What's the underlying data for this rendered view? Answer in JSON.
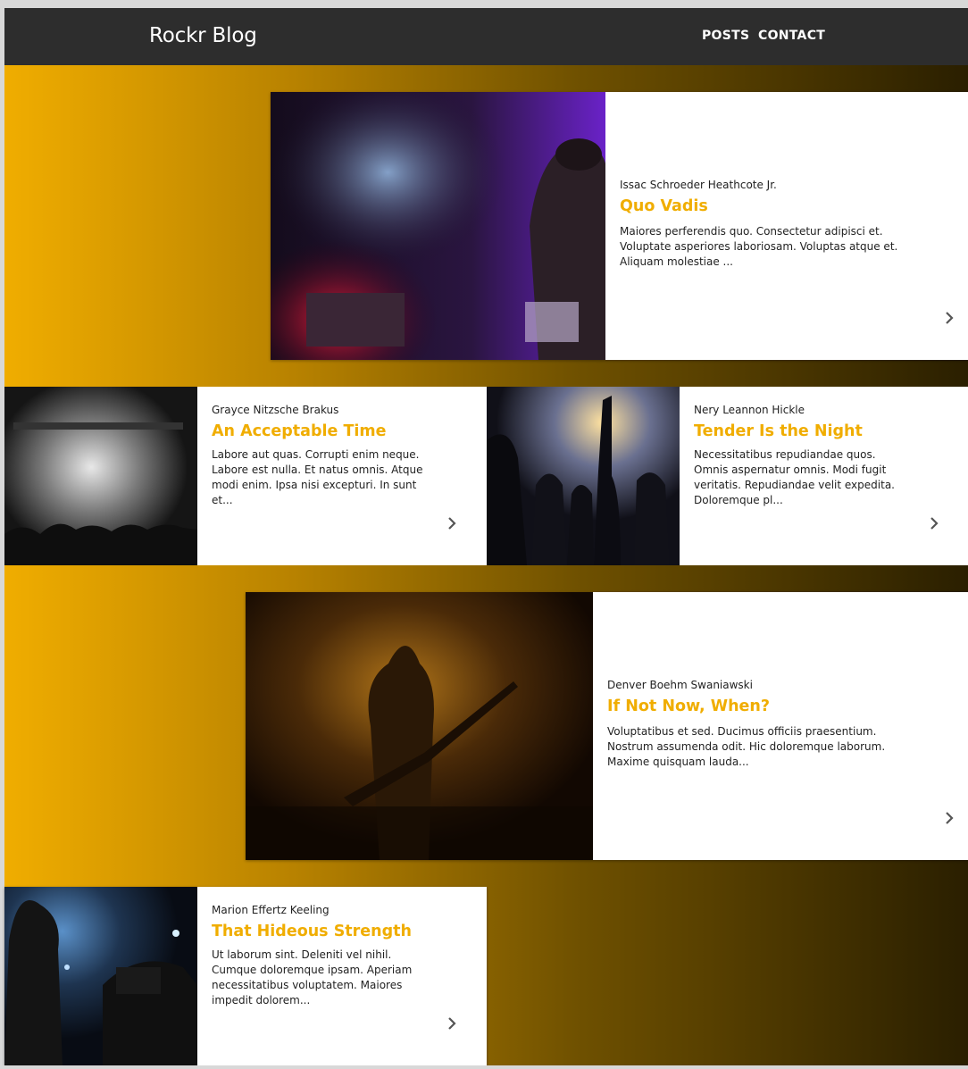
{
  "brand": "Rockr Blog",
  "nav": {
    "posts": "POSTS",
    "contact": "CONTACT"
  },
  "colors": {
    "accent": "#f0ad00",
    "navbar": "#2d2d2d"
  },
  "posts": [
    {
      "author": "Issac Schroeder Heathcote Jr.",
      "title": "Quo Vadis",
      "excerpt": "Maiores perferendis quo. Consectetur adipisci et. Voluptate asperiores laboriosam. Voluptas atque et. Aliquam molestiae ...",
      "icon": "chevron-right-icon"
    },
    {
      "author": "Grayce Nitzsche Brakus",
      "title": "An Acceptable Time",
      "excerpt": "Labore aut quas. Corrupti enim neque. Labore est nulla. Et natus omnis. Atque modi enim. Ipsa nisi excepturi. In sunt et...",
      "icon": "chevron-right-icon"
    },
    {
      "author": "Nery Leannon Hickle",
      "title": "Tender Is the Night",
      "excerpt": "Necessitatibus repudiandae quos. Omnis aspernatur omnis. Modi fugit veritatis. Repudiandae velit expedita. Doloremque pl...",
      "icon": "chevron-right-icon"
    },
    {
      "author": "Denver Boehm Swaniawski",
      "title": "If Not Now, When?",
      "excerpt": "Voluptatibus et sed. Ducimus officiis praesentium. Nostrum assumenda odit. Hic doloremque laborum. Maxime quisquam lauda...",
      "icon": "chevron-right-icon"
    },
    {
      "author": "Marion Effertz Keeling",
      "title": "That Hideous Strength",
      "excerpt": "Ut laborum sint. Deleniti vel nihil. Cumque doloremque ipsam. Aperiam necessitatibus voluptatem. Maiores impedit dolorem...",
      "icon": "chevron-right-icon"
    }
  ]
}
